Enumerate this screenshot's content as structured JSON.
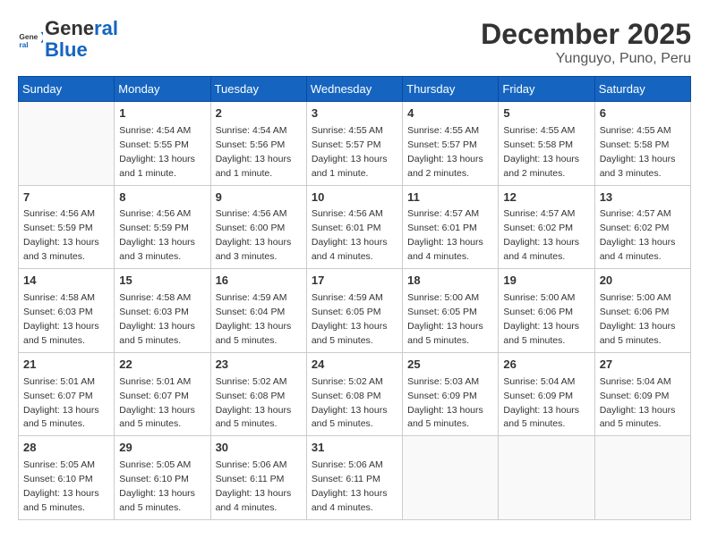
{
  "header": {
    "logo_general": "General",
    "logo_blue": "Blue",
    "month_year": "December 2025",
    "location": "Yunguyo, Puno, Peru"
  },
  "weekdays": [
    "Sunday",
    "Monday",
    "Tuesday",
    "Wednesday",
    "Thursday",
    "Friday",
    "Saturday"
  ],
  "weeks": [
    [
      {
        "day": null
      },
      {
        "day": 1,
        "sunrise": "4:54 AM",
        "sunset": "5:55 PM",
        "daylight": "13 hours and 1 minute."
      },
      {
        "day": 2,
        "sunrise": "4:54 AM",
        "sunset": "5:56 PM",
        "daylight": "13 hours and 1 minute."
      },
      {
        "day": 3,
        "sunrise": "4:55 AM",
        "sunset": "5:57 PM",
        "daylight": "13 hours and 1 minute."
      },
      {
        "day": 4,
        "sunrise": "4:55 AM",
        "sunset": "5:57 PM",
        "daylight": "13 hours and 2 minutes."
      },
      {
        "day": 5,
        "sunrise": "4:55 AM",
        "sunset": "5:58 PM",
        "daylight": "13 hours and 2 minutes."
      },
      {
        "day": 6,
        "sunrise": "4:55 AM",
        "sunset": "5:58 PM",
        "daylight": "13 hours and 3 minutes."
      }
    ],
    [
      {
        "day": 7,
        "sunrise": "4:56 AM",
        "sunset": "5:59 PM",
        "daylight": "13 hours and 3 minutes."
      },
      {
        "day": 8,
        "sunrise": "4:56 AM",
        "sunset": "5:59 PM",
        "daylight": "13 hours and 3 minutes."
      },
      {
        "day": 9,
        "sunrise": "4:56 AM",
        "sunset": "6:00 PM",
        "daylight": "13 hours and 3 minutes."
      },
      {
        "day": 10,
        "sunrise": "4:56 AM",
        "sunset": "6:01 PM",
        "daylight": "13 hours and 4 minutes."
      },
      {
        "day": 11,
        "sunrise": "4:57 AM",
        "sunset": "6:01 PM",
        "daylight": "13 hours and 4 minutes."
      },
      {
        "day": 12,
        "sunrise": "4:57 AM",
        "sunset": "6:02 PM",
        "daylight": "13 hours and 4 minutes."
      },
      {
        "day": 13,
        "sunrise": "4:57 AM",
        "sunset": "6:02 PM",
        "daylight": "13 hours and 4 minutes."
      }
    ],
    [
      {
        "day": 14,
        "sunrise": "4:58 AM",
        "sunset": "6:03 PM",
        "daylight": "13 hours and 5 minutes."
      },
      {
        "day": 15,
        "sunrise": "4:58 AM",
        "sunset": "6:03 PM",
        "daylight": "13 hours and 5 minutes."
      },
      {
        "day": 16,
        "sunrise": "4:59 AM",
        "sunset": "6:04 PM",
        "daylight": "13 hours and 5 minutes."
      },
      {
        "day": 17,
        "sunrise": "4:59 AM",
        "sunset": "6:05 PM",
        "daylight": "13 hours and 5 minutes."
      },
      {
        "day": 18,
        "sunrise": "5:00 AM",
        "sunset": "6:05 PM",
        "daylight": "13 hours and 5 minutes."
      },
      {
        "day": 19,
        "sunrise": "5:00 AM",
        "sunset": "6:06 PM",
        "daylight": "13 hours and 5 minutes."
      },
      {
        "day": 20,
        "sunrise": "5:00 AM",
        "sunset": "6:06 PM",
        "daylight": "13 hours and 5 minutes."
      }
    ],
    [
      {
        "day": 21,
        "sunrise": "5:01 AM",
        "sunset": "6:07 PM",
        "daylight": "13 hours and 5 minutes."
      },
      {
        "day": 22,
        "sunrise": "5:01 AM",
        "sunset": "6:07 PM",
        "daylight": "13 hours and 5 minutes."
      },
      {
        "day": 23,
        "sunrise": "5:02 AM",
        "sunset": "6:08 PM",
        "daylight": "13 hours and 5 minutes."
      },
      {
        "day": 24,
        "sunrise": "5:02 AM",
        "sunset": "6:08 PM",
        "daylight": "13 hours and 5 minutes."
      },
      {
        "day": 25,
        "sunrise": "5:03 AM",
        "sunset": "6:09 PM",
        "daylight": "13 hours and 5 minutes."
      },
      {
        "day": 26,
        "sunrise": "5:04 AM",
        "sunset": "6:09 PM",
        "daylight": "13 hours and 5 minutes."
      },
      {
        "day": 27,
        "sunrise": "5:04 AM",
        "sunset": "6:09 PM",
        "daylight": "13 hours and 5 minutes."
      }
    ],
    [
      {
        "day": 28,
        "sunrise": "5:05 AM",
        "sunset": "6:10 PM",
        "daylight": "13 hours and 5 minutes."
      },
      {
        "day": 29,
        "sunrise": "5:05 AM",
        "sunset": "6:10 PM",
        "daylight": "13 hours and 5 minutes."
      },
      {
        "day": 30,
        "sunrise": "5:06 AM",
        "sunset": "6:11 PM",
        "daylight": "13 hours and 4 minutes."
      },
      {
        "day": 31,
        "sunrise": "5:06 AM",
        "sunset": "6:11 PM",
        "daylight": "13 hours and 4 minutes."
      },
      {
        "day": null
      },
      {
        "day": null
      },
      {
        "day": null
      }
    ]
  ],
  "labels": {
    "sunrise": "Sunrise:",
    "sunset": "Sunset:",
    "daylight": "Daylight:"
  }
}
